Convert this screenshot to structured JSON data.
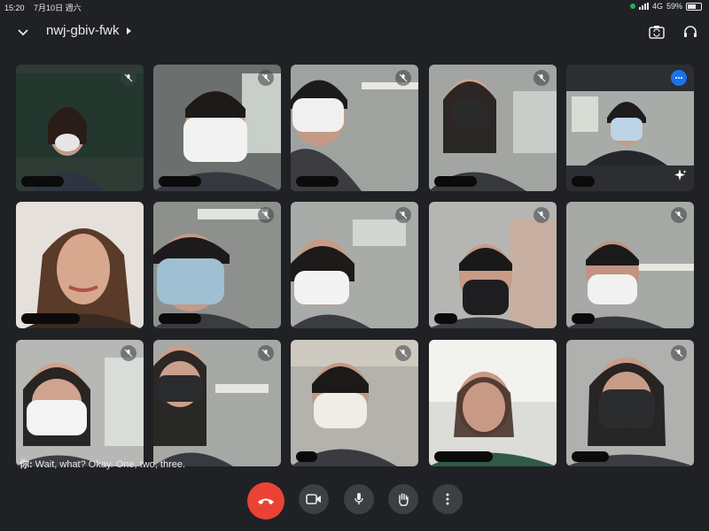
{
  "status_bar": {
    "time": "15:20",
    "date": "7月10日 週六",
    "network": "4G",
    "battery": "59%"
  },
  "meeting": {
    "code": "nwj-gbiv-fwk"
  },
  "icons": {
    "back": "chevron-down-icon",
    "title_arrow": "caret-right-icon",
    "camera_switch": "camera-switch-icon",
    "audio": "headphones-icon",
    "mic_off": "mic-off-icon",
    "more": "more-horizontal-icon",
    "effects": "sparkle-icon"
  },
  "caption": {
    "speaker": "你:",
    "text": "Wait, what? Okay. One, two, three."
  },
  "controls": [
    {
      "name": "end-call-button",
      "icon": "phone-hangup-icon"
    },
    {
      "name": "camera-button",
      "icon": "video-camera-icon"
    },
    {
      "name": "microphone-button",
      "icon": "microphone-icon"
    },
    {
      "name": "raise-hand-button",
      "icon": "hand-icon"
    },
    {
      "name": "more-options-button",
      "icon": "more-vertical-icon"
    }
  ],
  "colors": {
    "background": "#202124",
    "end_call": "#ea4335",
    "accent": "#1a73e8",
    "battery_dot": "#34a853"
  }
}
